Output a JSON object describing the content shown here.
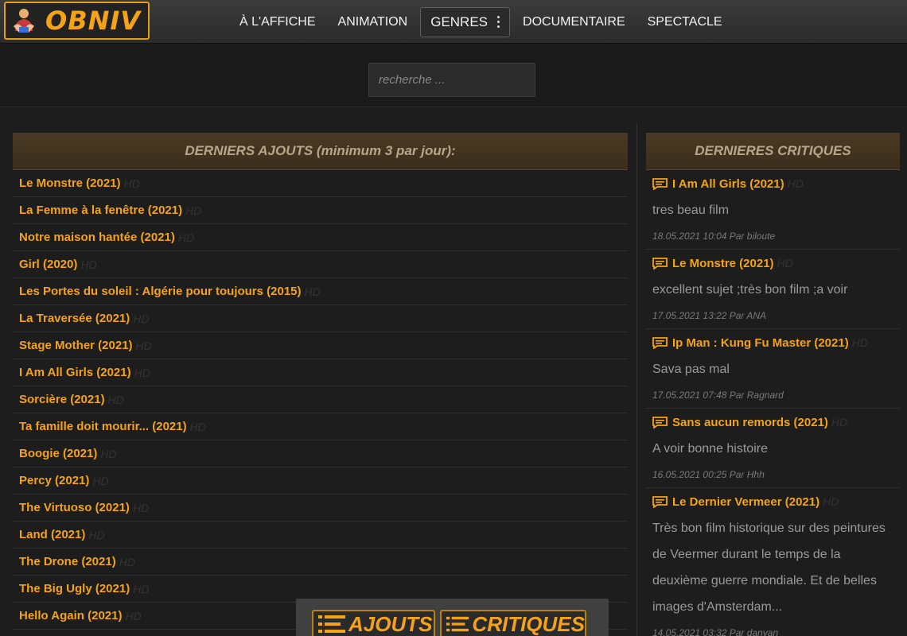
{
  "header": {
    "logo_text": "OBNIV",
    "nav": [
      {
        "label": "À L'AFFICHE"
      },
      {
        "label": "ANIMATION"
      },
      {
        "label": "GENRES"
      },
      {
        "label": "DOCUMENTAIRE"
      },
      {
        "label": "SPECTACLE"
      }
    ]
  },
  "search": {
    "placeholder": "recherche ..."
  },
  "latest": {
    "header": "DERNIERS AJOUTS (minimum 3 par jour):",
    "items": [
      {
        "title": "Le Monstre (2021)",
        "badge": "HD"
      },
      {
        "title": "La Femme à la fenêtre (2021)",
        "badge": "HD"
      },
      {
        "title": "Notre maison hantée (2021)",
        "badge": "HD"
      },
      {
        "title": "Girl (2020)",
        "badge": "HD"
      },
      {
        "title": "Les Portes du soleil : Algérie pour toujours (2015)",
        "badge": "HD"
      },
      {
        "title": "La Traversée (2021)",
        "badge": "HD"
      },
      {
        "title": "Stage Mother (2021)",
        "badge": "HD"
      },
      {
        "title": "I Am All Girls (2021)",
        "badge": "HD"
      },
      {
        "title": "Sorcière (2021)",
        "badge": "HD"
      },
      {
        "title": "Ta famille doit mourir... (2021)",
        "badge": "HD"
      },
      {
        "title": "Boogie (2021)",
        "badge": "HD"
      },
      {
        "title": "Percy (2021)",
        "badge": "HD"
      },
      {
        "title": "The Virtuoso (2021)",
        "badge": "HD"
      },
      {
        "title": "Land (2021)",
        "badge": "HD"
      },
      {
        "title": "The Drone (2021)",
        "badge": "HD"
      },
      {
        "title": "The Big Ugly (2021)",
        "badge": "HD"
      },
      {
        "title": "Hello Again (2021)",
        "badge": "HD"
      }
    ]
  },
  "reviews": {
    "header": "DERNIERES CRITIQUES",
    "items": [
      {
        "title": "I Am All Girls (2021)",
        "badge": "HD",
        "lines": [
          "tres beau film"
        ],
        "meta": "18.05.2021 10:04 Par biloute"
      },
      {
        "title": "Le Monstre (2021)",
        "badge": "HD",
        "lines": [
          "excellent sujet ;très bon film ;a voir"
        ],
        "meta": "17.05.2021 13:22 Par ANA"
      },
      {
        "title": "Ip Man : Kung Fu Master (2021)",
        "badge": "HD",
        "lines": [
          "Sava pas mal"
        ],
        "meta": "17.05.2021 07:48 Par Ragnard"
      },
      {
        "title": "Sans aucun remords (2021)",
        "badge": "HD",
        "lines": [
          "A voir bonne histoire"
        ],
        "meta": "16.05.2021 00:25 Par Hhh"
      },
      {
        "title": "Le Dernier Vermeer (2021)",
        "badge": "HD",
        "lines": [
          "Très bon film historique sur des peintures",
          "de Veermer durant le temps de la",
          "deuxième guerre mondiale. Et de belles",
          "images d'Amsterdam..."
        ],
        "meta": "14.05.2021 03:32 Par danyan"
      }
    ]
  },
  "bottom_bar": {
    "ajouts_label": "AJOUTS",
    "critiques_label": "CRITIQUES"
  },
  "colors": {
    "accent": "#f5a315",
    "background": "#1d1d1d"
  }
}
